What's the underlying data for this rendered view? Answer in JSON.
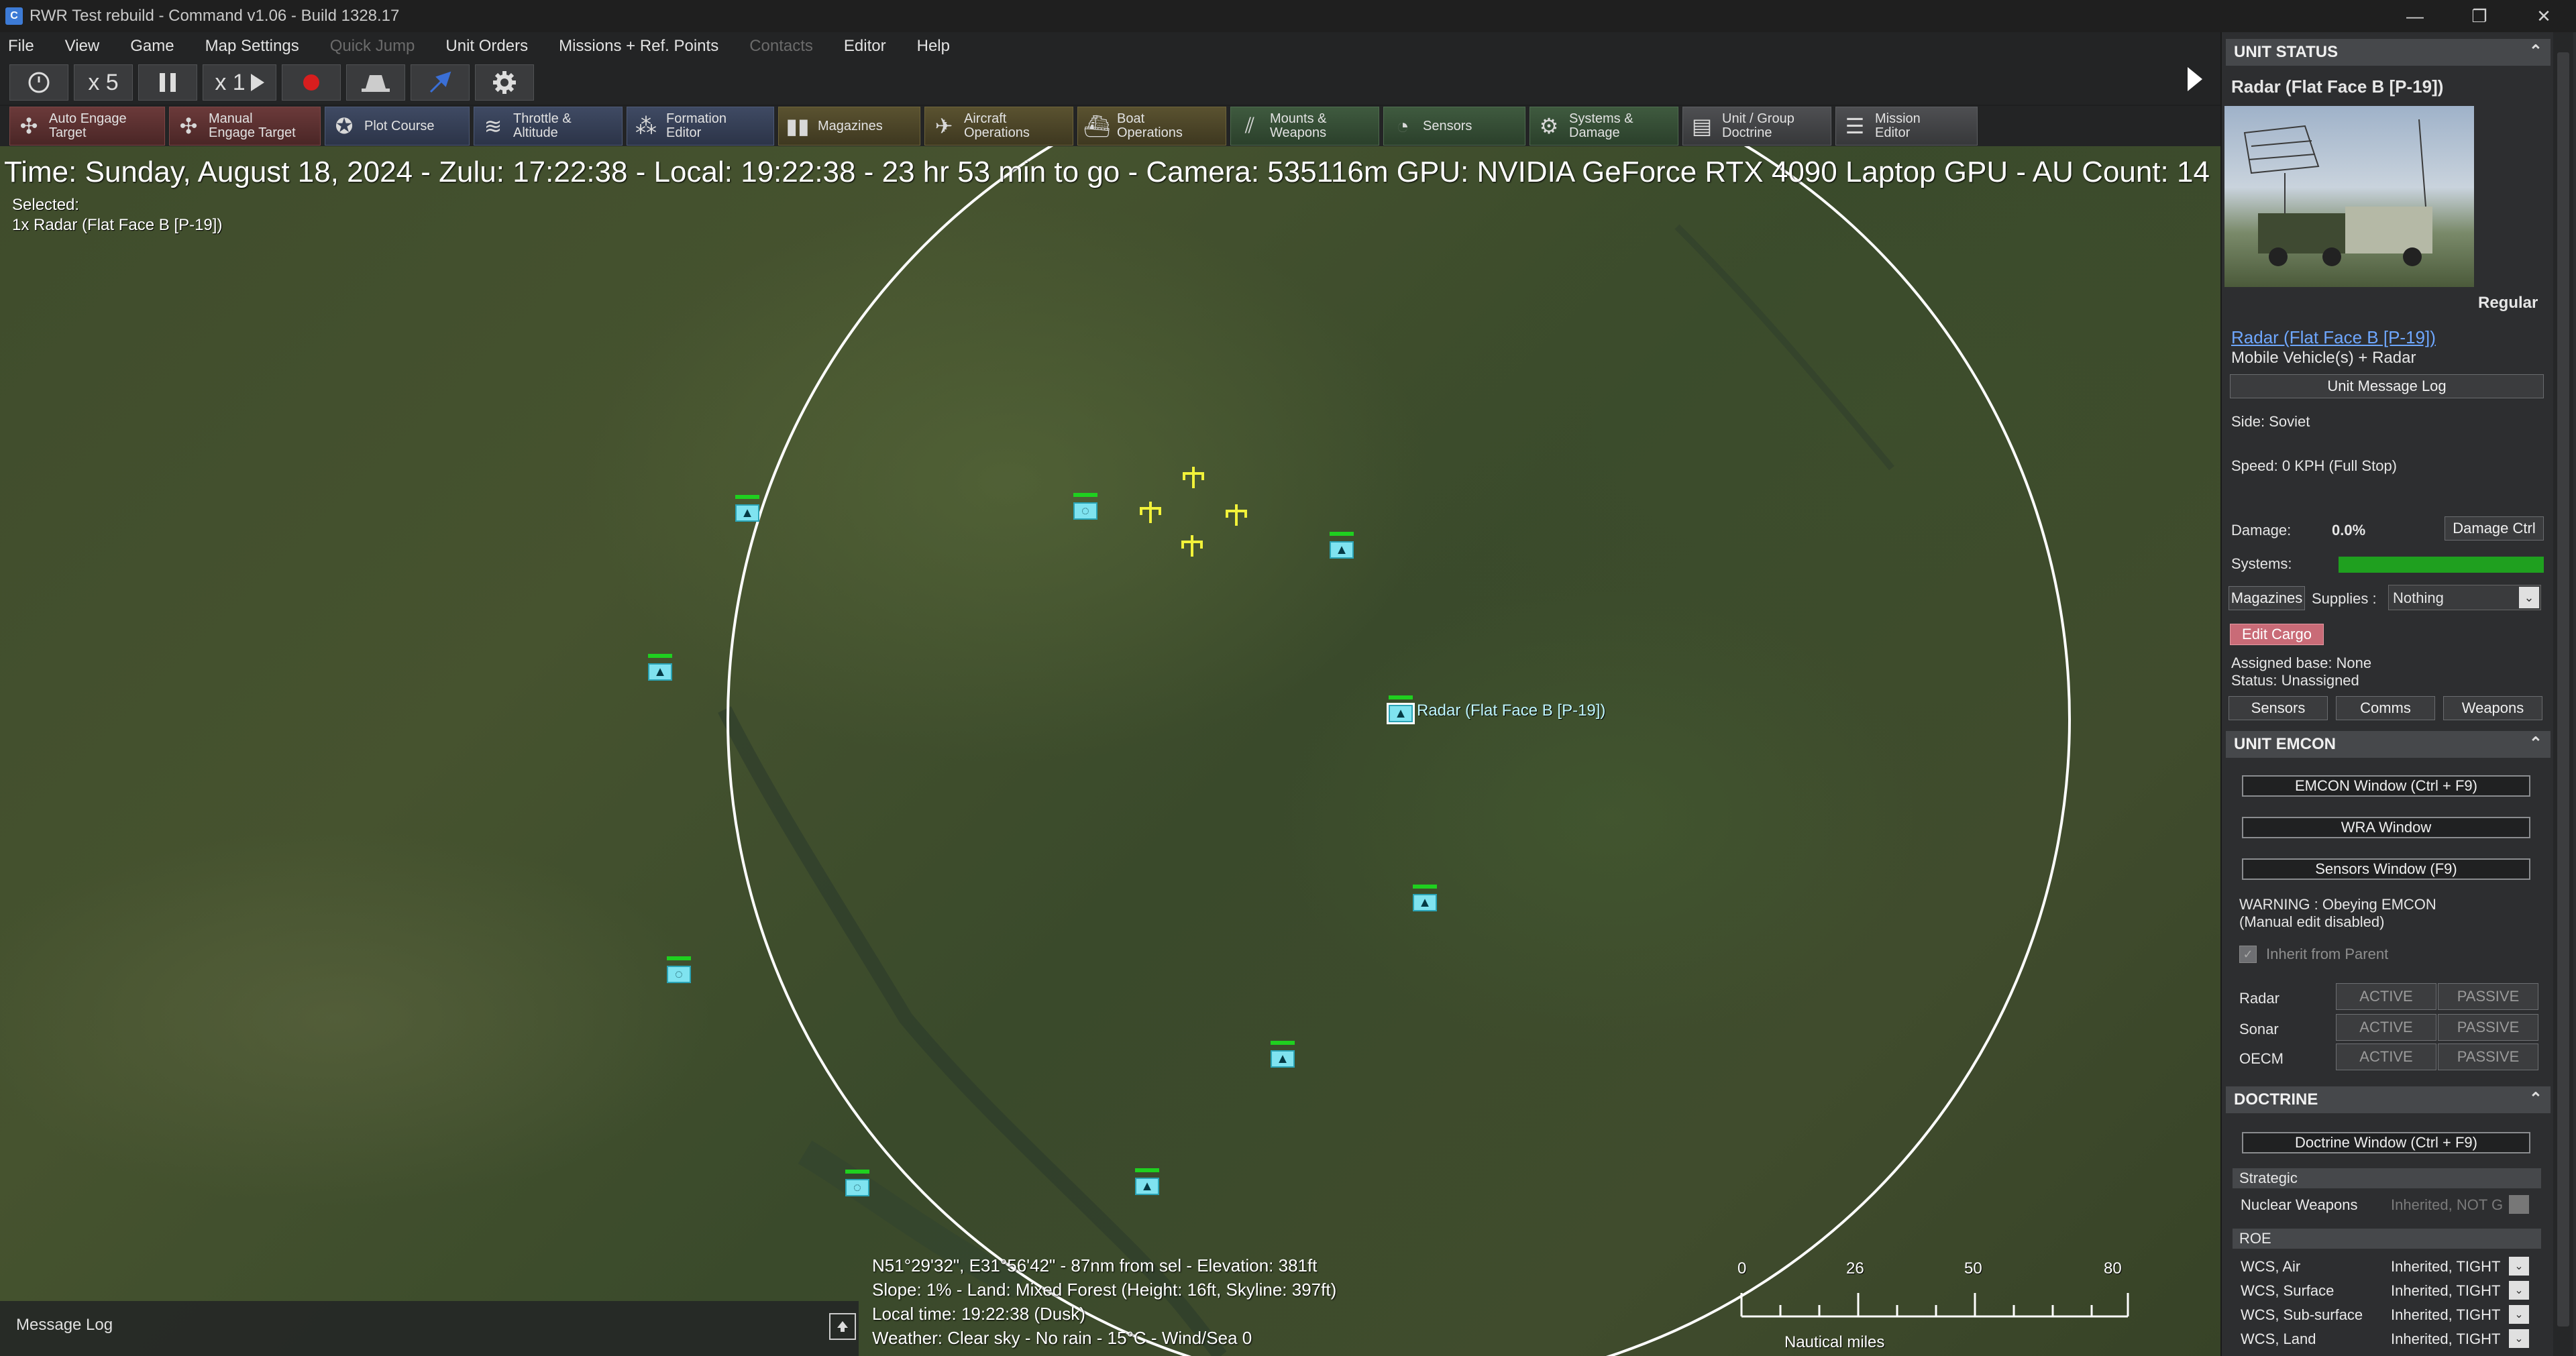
{
  "window": {
    "title": "RWR Test rebuild - Command v1.06 - Build 1328.17",
    "minimize": "—",
    "maximize": "❐",
    "close": "✕"
  },
  "menu": {
    "items": [
      "File",
      "View",
      "Game",
      "Map Settings",
      "Quick Jump",
      "Unit Orders",
      "Missions + Ref. Points",
      "Contacts",
      "Editor",
      "Help"
    ],
    "disabled": [
      "Quick Jump",
      "Contacts"
    ]
  },
  "sim": {
    "compression_label": "x 5",
    "speed_label": "x 1"
  },
  "toolbar": {
    "auto_engage": "Auto Engage\nTarget",
    "manual_engage": "Manual\nEngage Target",
    "plot_course": "Plot Course",
    "throttle": "Throttle &\nAltitude",
    "formation": "Formation\nEditor",
    "magazines": "Magazines",
    "aircraft_ops": "Aircraft\nOperations",
    "boat_ops": "Boat\nOperations",
    "mounts": "Mounts &\nWeapons",
    "sensors": "Sensors",
    "systems": "Systems &\nDamage",
    "doctrine": "Unit / Group\nDoctrine",
    "mission_editor": "Mission\nEditor"
  },
  "map": {
    "status_line": "Time: Sunday, August 18, 2024 - Zulu: 17:22:38 - Local: 19:22:38 - 23 hr 53 min to go -  Camera: 535116m  GPU: NVIDIA GeForce RTX 4090 Laptop GPU - AU Count: 14",
    "selected_header": "Selected:",
    "selected_item": "1x Radar (Flat Face B [P-19])",
    "selected_unit_label": "Radar (Flat Face B [P-19])",
    "info": {
      "coords": "N51°29'32\", E31°56'42\" - 87nm from sel - Elevation: 381ft",
      "slope": "Slope: 1%  - Land: Mixed Forest (Height: 16ft, Skyline: 397ft)",
      "local_time": "Local time: 19:22:38 (Dusk)",
      "weather": "Weather: Clear sky - No rain - 15°C - Wind/Sea 0"
    },
    "scale": {
      "ticks": [
        "0",
        "26",
        "50",
        "80"
      ],
      "unit": "Nautical miles"
    }
  },
  "message_log": {
    "label": "Message Log"
  },
  "unit_status": {
    "header": "UNIT STATUS",
    "unit_name": "Radar (Flat Face B [P-19])",
    "proficiency": "Regular",
    "link_name": "Radar (Flat Face B [P-19])",
    "unit_type": "Mobile Vehicle(s) + Radar",
    "message_log_btn": "Unit Message Log",
    "side": "Side: Soviet",
    "speed": "Speed: 0 KPH (Full Stop)",
    "damage_label": "Damage:",
    "damage_value": "0.0%",
    "damage_ctrl_btn": "Damage Ctrl",
    "systems_label": "Systems:",
    "systems_health": 1.0,
    "magazines_btn": "Magazines",
    "supplies_label": "Supplies :",
    "supplies_value": "Nothing",
    "edit_cargo_btn": "Edit Cargo",
    "assigned_base": "Assigned base: None",
    "status": "Status: Unassigned",
    "sensors_btn": "Sensors",
    "comms_btn": "Comms",
    "weapons_btn": "Weapons"
  },
  "emcon": {
    "header": "UNIT EMCON",
    "emcon_window_btn": "EMCON Window (Ctrl + F9)",
    "wra_window_btn": "WRA Window",
    "sensors_window_btn": "Sensors Window (F9)",
    "warning": "WARNING : Obeying EMCON",
    "warning_sub": "(Manual edit disabled)",
    "inherit_label": "Inherit from Parent",
    "rows": [
      {
        "label": "Radar",
        "active": "ACTIVE",
        "passive": "PASSIVE"
      },
      {
        "label": "Sonar",
        "active": "ACTIVE",
        "passive": "PASSIVE"
      },
      {
        "label": "OECM",
        "active": "ACTIVE",
        "passive": "PASSIVE"
      }
    ]
  },
  "doctrine": {
    "header": "DOCTRINE",
    "doctrine_window_btn": "Doctrine Window (Ctrl + F9)",
    "strategic_label": "Strategic",
    "nuclear_label": "Nuclear Weapons",
    "nuclear_value": "Inherited, NOT G",
    "roe_label": "ROE",
    "wcs_rows": [
      {
        "label": "WCS, Air",
        "value": "Inherited, TIGHT"
      },
      {
        "label": "WCS, Surface",
        "value": "Inherited, TIGHT"
      },
      {
        "label": "WCS, Sub-surface",
        "value": "Inherited, TIGHT"
      },
      {
        "label": "WCS, Land",
        "value": "Inherited, TIGHT"
      }
    ]
  },
  "colors": {
    "friendly_unit": "#7fe3f0",
    "unknown_contact": "#f2f23a",
    "health_bar": "#1fd01f",
    "range_ring": "#ffffff",
    "link": "#6ea7ff"
  },
  "icons": {
    "unit_symbol": "triangle-up-icon",
    "sam_symbol": "radar-dish-icon",
    "air_contact": "aircraft-contact-icon"
  }
}
